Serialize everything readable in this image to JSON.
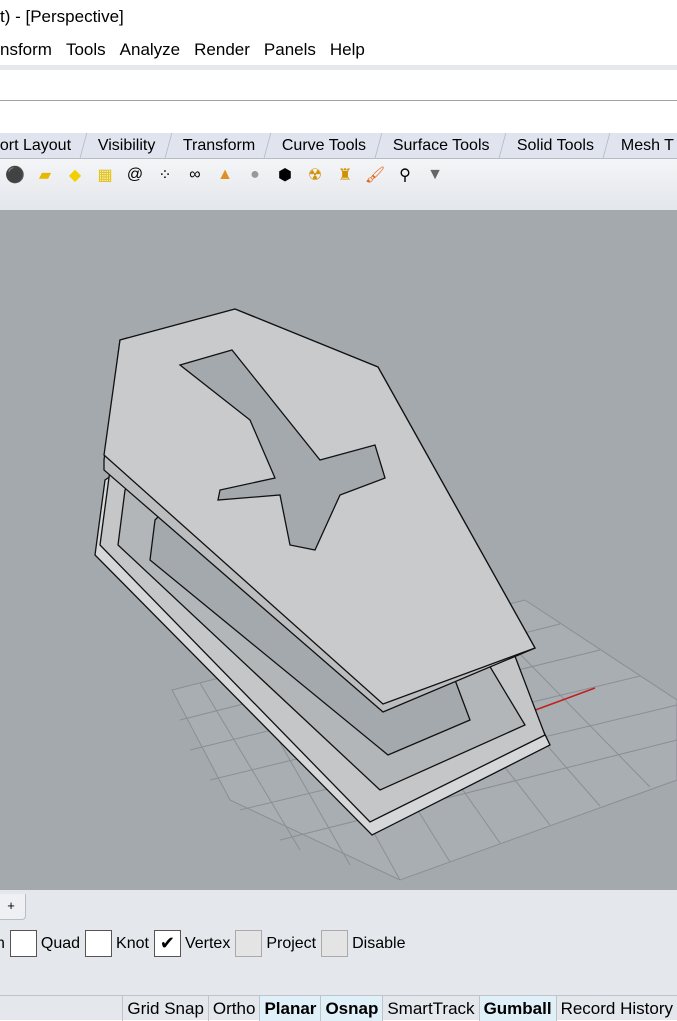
{
  "window": {
    "title": "t) - [Perspective]"
  },
  "menu": [
    "nsform",
    "Tools",
    "Analyze",
    "Render",
    "Panels",
    "Help"
  ],
  "tabs": [
    "ort Layout",
    "Visibility",
    "Transform",
    "Curve Tools",
    "Surface Tools",
    "Solid Tools",
    "Mesh T"
  ],
  "toolbar_icons": [
    "sphere-icon",
    "box-icon",
    "surface-icon",
    "grid-surface-icon",
    "spiral-icon",
    "points-icon",
    "chain-icon",
    "pyramid-icon",
    "shaded-sphere-icon",
    "cube-icon",
    "light-icon",
    "render-icon",
    "paintbrush-icon",
    "zoom-icon",
    "filter-icon"
  ],
  "panel": {
    "tab_icon": "+",
    "snaps": [
      {
        "label": "Quad",
        "checked": false,
        "disabled": false
      },
      {
        "label": "Knot",
        "checked": false,
        "disabled": false
      },
      {
        "label": "Vertex",
        "checked": true,
        "disabled": false
      },
      {
        "label": "Project",
        "checked": false,
        "disabled": true
      },
      {
        "label": "Disable",
        "checked": false,
        "disabled": true
      }
    ],
    "first_label": "n"
  },
  "status": [
    {
      "label": "Grid Snap",
      "on": false
    },
    {
      "label": "Ortho",
      "on": false
    },
    {
      "label": "Planar",
      "on": true
    },
    {
      "label": "Osnap",
      "on": true
    },
    {
      "label": "SmartTrack",
      "on": false
    },
    {
      "label": "Gumball",
      "on": true
    },
    {
      "label": "Record History",
      "on": false
    }
  ],
  "colors": {
    "viewport": "#a4a9ae",
    "panel": "#e4e7ec",
    "grid": "#8e9398"
  }
}
